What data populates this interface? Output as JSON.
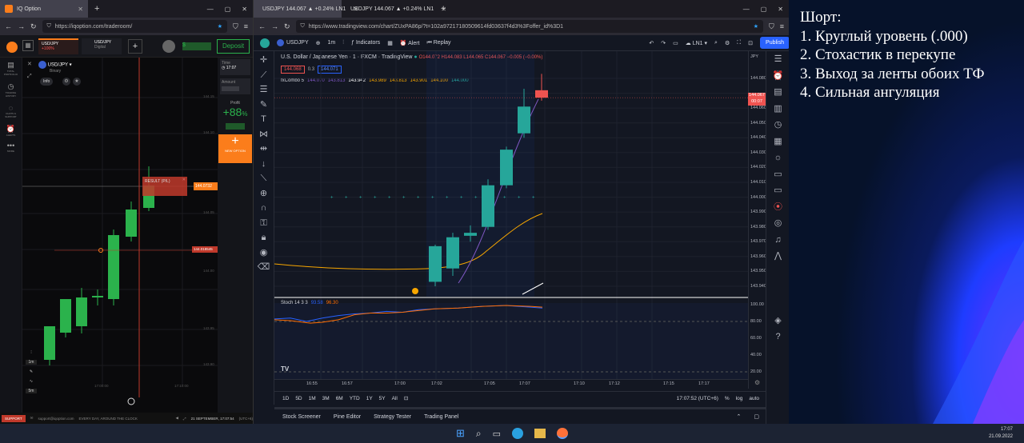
{
  "left": {
    "tab_title": "IQ Option",
    "url": "https://iqoption.com/traderoom/",
    "asset_top": "USD/JPY",
    "asset_top_pct": "+100%",
    "asset_top2": "USD/JPY",
    "asset_top2_sub": "Digital",
    "deposit": "Deposit",
    "balance": "$       ",
    "sidebar": [
      "TOTAL PORTFOLIO",
      "TRADING HISTORY",
      "CHATS & SUPPORT",
      "ALERTS",
      "MORE"
    ],
    "chart_asset": "USD/JPY",
    "chart_asset_sub": "Binary",
    "info": "Info",
    "time_label": "Time",
    "time_value": "17:07",
    "amount_label": "Amount",
    "profit_label": "Profit",
    "profit_value": "+88",
    "profit_pct": "%",
    "new_option": "NEW OPTION",
    "result_label": "RESULT (P/L)",
    "price_tag": "144.0732",
    "price_tag2": "144.018545",
    "y_labels": [
      "144.15",
      "144.10",
      "144.05",
      "144.00",
      "143.95",
      "143.90"
    ],
    "x_labels": [
      "17:00:00",
      "17:10:00"
    ],
    "tf_labels": [
      "1m",
      "1m",
      "5m"
    ],
    "status_support": "SUPPORT",
    "status_email": "support@iqoption.com",
    "status_tagline": "EVERY DAY, AROUND THE CLOCK",
    "status_date": "21 SEPTEMBER, 17:07:54",
    "status_tz": "(UTC+6)"
  },
  "right": {
    "tab1": "USDJPY 144.067 ▲ +0.24% LN1",
    "tab2": "USDJPY 144.067 ▲ +0.24% LN1",
    "url": "https://www.tradingview.com/chart/ZUxPA86p/?t=102a97217180509614fd03637f4d3%3Foffer_id%3D1",
    "symbol": "USDJPY",
    "interval": "1m",
    "indicators": "Indicators",
    "alert": "Alert",
    "replay": "Replay",
    "layout": "LN1",
    "publish": "Publish",
    "title": "U.S. Dollar / Japanese Yen · 1 · FXCM · TradingView",
    "ohlc": "O144.072 H144.083 L144.065 C144.067 −0.005 (−0.00%)",
    "bid": "144.068",
    "spread": "0.3",
    "ask": "144.071",
    "combo_label": "fxCombo 5",
    "combo_vals": [
      "144.070",
      "143.813",
      "143.942",
      "143.989",
      "143.813",
      "143.901",
      "144.100",
      "144.000"
    ],
    "currency": "JPY",
    "price_axis": [
      "144.080",
      "144.060",
      "144.050",
      "144.040",
      "144.030",
      "144.020",
      "144.010",
      "144.000",
      "143.990",
      "143.980",
      "143.970",
      "143.960",
      "143.950",
      "143.940"
    ],
    "last_price": "144.067",
    "last_time": "00:07",
    "stoch_label": "Stoch 14 3 3",
    "stoch_k": "93.58",
    "stoch_d": "96.30",
    "stoch_axis": [
      "100.00",
      "80.00",
      "60.00",
      "40.00",
      "20.00"
    ],
    "time_axis": [
      "16:55",
      "16:57",
      "17:00",
      "17:02",
      "17:05",
      "17:07",
      "17:10",
      "17:12",
      "17:15",
      "17:17"
    ],
    "ranges": [
      "1D",
      "5D",
      "1M",
      "3M",
      "6M",
      "YTD",
      "1Y",
      "5Y",
      "All"
    ],
    "clock": "17:07:52 (UTC+6)",
    "pct": "%",
    "log": "log",
    "auto": "auto",
    "bottom_tabs": [
      "Stock Screener",
      "Pine Editor",
      "Strategy Tester",
      "Trading Panel"
    ]
  },
  "notes": {
    "title": "Шорт:",
    "items": [
      "1. Круглый уровень (.000)",
      "2. Стохастик в перекупе",
      "3. Выход за ленты обоих ТФ",
      "4. Сильная ангуляция"
    ]
  },
  "taskbar": {
    "time": "17:07",
    "date": "21.09.2022"
  },
  "colors": {
    "up": "#26a69a",
    "down": "#ef5350",
    "iq_up": "#2bb24c",
    "iq_orange": "#fb7d1b",
    "tv_blue": "#2962ff"
  }
}
